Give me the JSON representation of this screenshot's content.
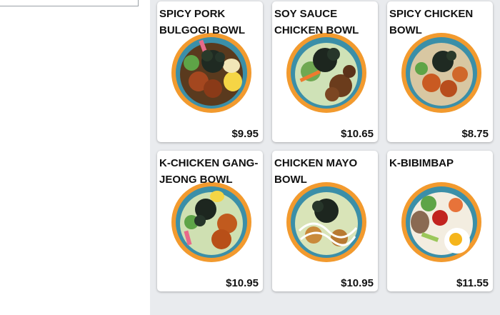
{
  "menu": {
    "items": [
      {
        "name": "SPICY PORK BULGOGI BOWL",
        "price": "$9.95",
        "image_icon": "pork-bulgogi-bowl-icon"
      },
      {
        "name": "SOY SAUCE CHICKEN BOWL",
        "price": "$10.65",
        "image_icon": "soy-chicken-bowl-icon"
      },
      {
        "name": "SPICY CHICKEN BOWL",
        "price": "$8.75",
        "image_icon": "spicy-chicken-bowl-icon"
      },
      {
        "name": "K-CHICKEN GANG-JEONG BOWL",
        "price": "$10.95",
        "image_icon": "gang-jeong-bowl-icon"
      },
      {
        "name": "CHICKEN MAYO BOWL",
        "price": "$10.95",
        "image_icon": "chicken-mayo-bowl-icon"
      },
      {
        "name": "K-BIBIMBAP",
        "price": "$11.55",
        "image_icon": "bibimbap-bowl-icon"
      }
    ]
  },
  "colors": {
    "plate_rim": "#f29a2e",
    "menu_background": "#e9ebee",
    "card_background": "#ffffff"
  }
}
